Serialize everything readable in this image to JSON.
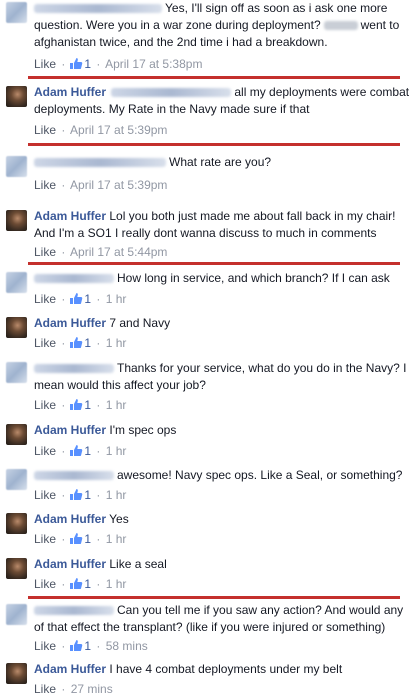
{
  "comments": [
    {
      "author": "",
      "author_blurred": true,
      "text": "Yes, I'll sign off as soon as i ask one more question. Were you in a war zone during deployment?",
      "text2": "went to afghanistan twice, and the 2nd time i had a breakdown.",
      "like": "Like",
      "likes": "1",
      "time": "April 17 at 5:38pm"
    },
    {
      "author": "Adam Huffer",
      "author_blurred": false,
      "text": "all my deployments were combat deployments. My Rate in the Navy made sure if that",
      "like": "Like",
      "likes": "",
      "time": "April 17 at 5:39pm"
    },
    {
      "author": "",
      "author_blurred": true,
      "text": "What rate are you?",
      "like": "Like",
      "likes": "",
      "time": "April 17 at 5:39pm"
    },
    {
      "author": "Adam Huffer",
      "author_blurred": false,
      "text": "Lol you both just made me about fall back in my chair! And I'm a SO1 I really dont wanna discuss to much in comments",
      "like": "Like",
      "likes": "",
      "time": "April 17 at 5:44pm"
    },
    {
      "author": "",
      "author_blurred": true,
      "text": "How long in service, and which branch? If I can ask",
      "like": "Like",
      "likes": "1",
      "time": "1 hr"
    },
    {
      "author": "Adam Huffer",
      "author_blurred": false,
      "text": "7 and Navy",
      "like": "Like",
      "likes": "1",
      "time": "1 hr"
    },
    {
      "author": "",
      "author_blurred": true,
      "text": "Thanks for your service, what do you do in the Navy? I mean would this affect your job?",
      "like": "Like",
      "likes": "1",
      "time": "1 hr"
    },
    {
      "author": "Adam Huffer",
      "author_blurred": false,
      "text": "I'm spec ops",
      "like": "Like",
      "likes": "1",
      "time": "1 hr"
    },
    {
      "author": "",
      "author_blurred": true,
      "text": "awesome! Navy spec ops. Like a Seal, or something?",
      "like": "Like",
      "likes": "1",
      "time": "1 hr"
    },
    {
      "author": "Adam Huffer",
      "author_blurred": false,
      "text": "Yes",
      "like": "Like",
      "likes": "1",
      "time": "1 hr"
    },
    {
      "author": "Adam Huffer",
      "author_blurred": false,
      "text": "Like a seal",
      "like": "Like",
      "likes": "1",
      "time": "1 hr"
    },
    {
      "author": "",
      "author_blurred": true,
      "text": "Can you tell me if you saw any action? And would any of that effect the transplant? (like if you were injured or something)",
      "like": "Like",
      "likes": "1",
      "time": "58 mins"
    },
    {
      "author": "Adam Huffer",
      "author_blurred": false,
      "text": "I have 4 combat deployments under my belt",
      "like": "Like",
      "likes": "",
      "time": "27 mins"
    }
  ],
  "separator_color": "#c4302d",
  "link_color": "#3b5998",
  "meta_color": "#9197a3"
}
